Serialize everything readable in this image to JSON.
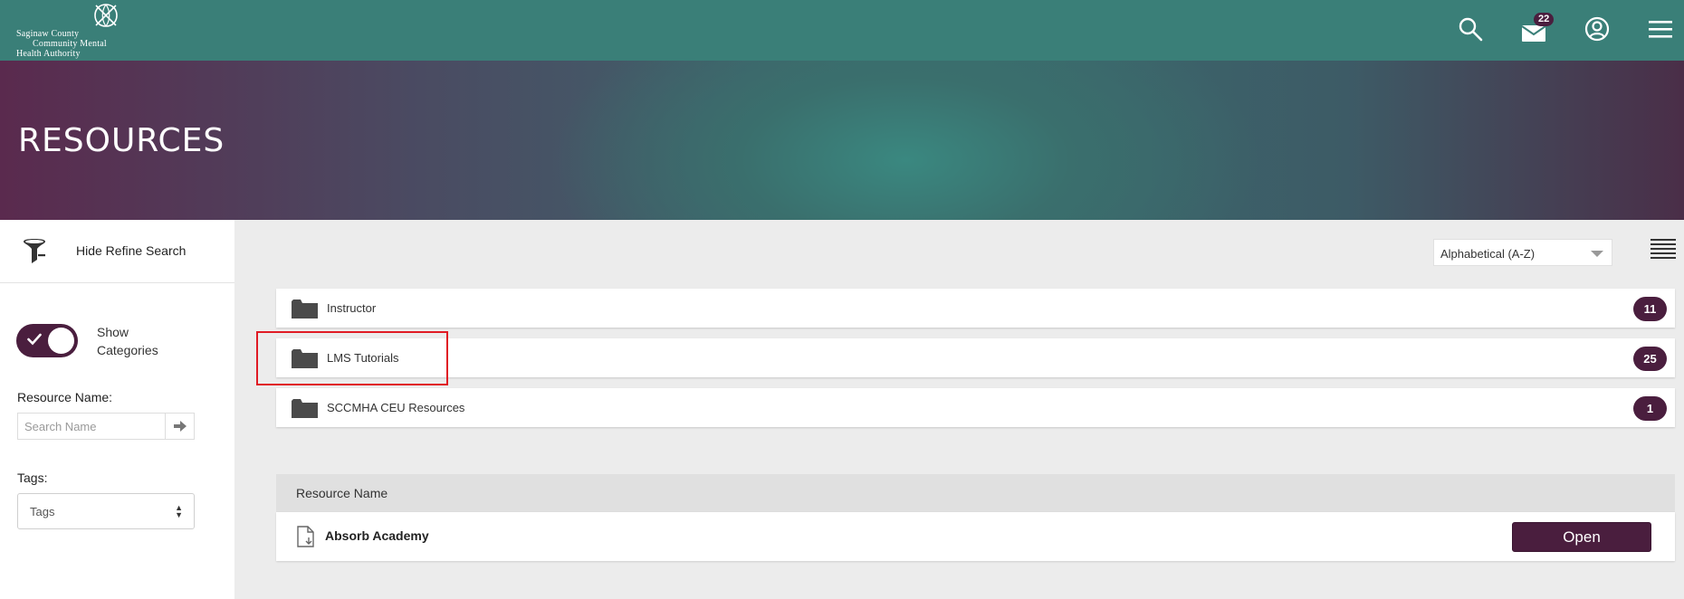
{
  "header": {
    "logo_lines": [
      "Saginaw County",
      "Community Mental",
      "Health Authority"
    ],
    "mail_count": "22",
    "icons": [
      "search-icon",
      "mail-icon",
      "user-icon",
      "menu-icon"
    ]
  },
  "hero": {
    "title": "RESOURCES"
  },
  "sidebar": {
    "refine_label": "Hide Refine Search",
    "toggle_label": "Show Categories",
    "toggle_on": true,
    "resource_name_label": "Resource Name:",
    "resource_name_placeholder": "Search Name",
    "resource_name_value": "",
    "tags_label": "Tags:",
    "tags_value": "Tags"
  },
  "main": {
    "sort_value": "Alphabetical (A-Z)",
    "folders": [
      {
        "name": "Instructor",
        "count": "11"
      },
      {
        "name": "LMS Tutorials",
        "count": "25"
      },
      {
        "name": "SCCMHA CEU Resources",
        "count": "1"
      }
    ],
    "table": {
      "column": "Resource Name",
      "rows": [
        {
          "name": "Absorb Academy",
          "action": "Open"
        }
      ]
    }
  },
  "colors": {
    "topbar": "#3a7f78",
    "accent": "#4a1e3e",
    "highlight": "#e01b24"
  }
}
